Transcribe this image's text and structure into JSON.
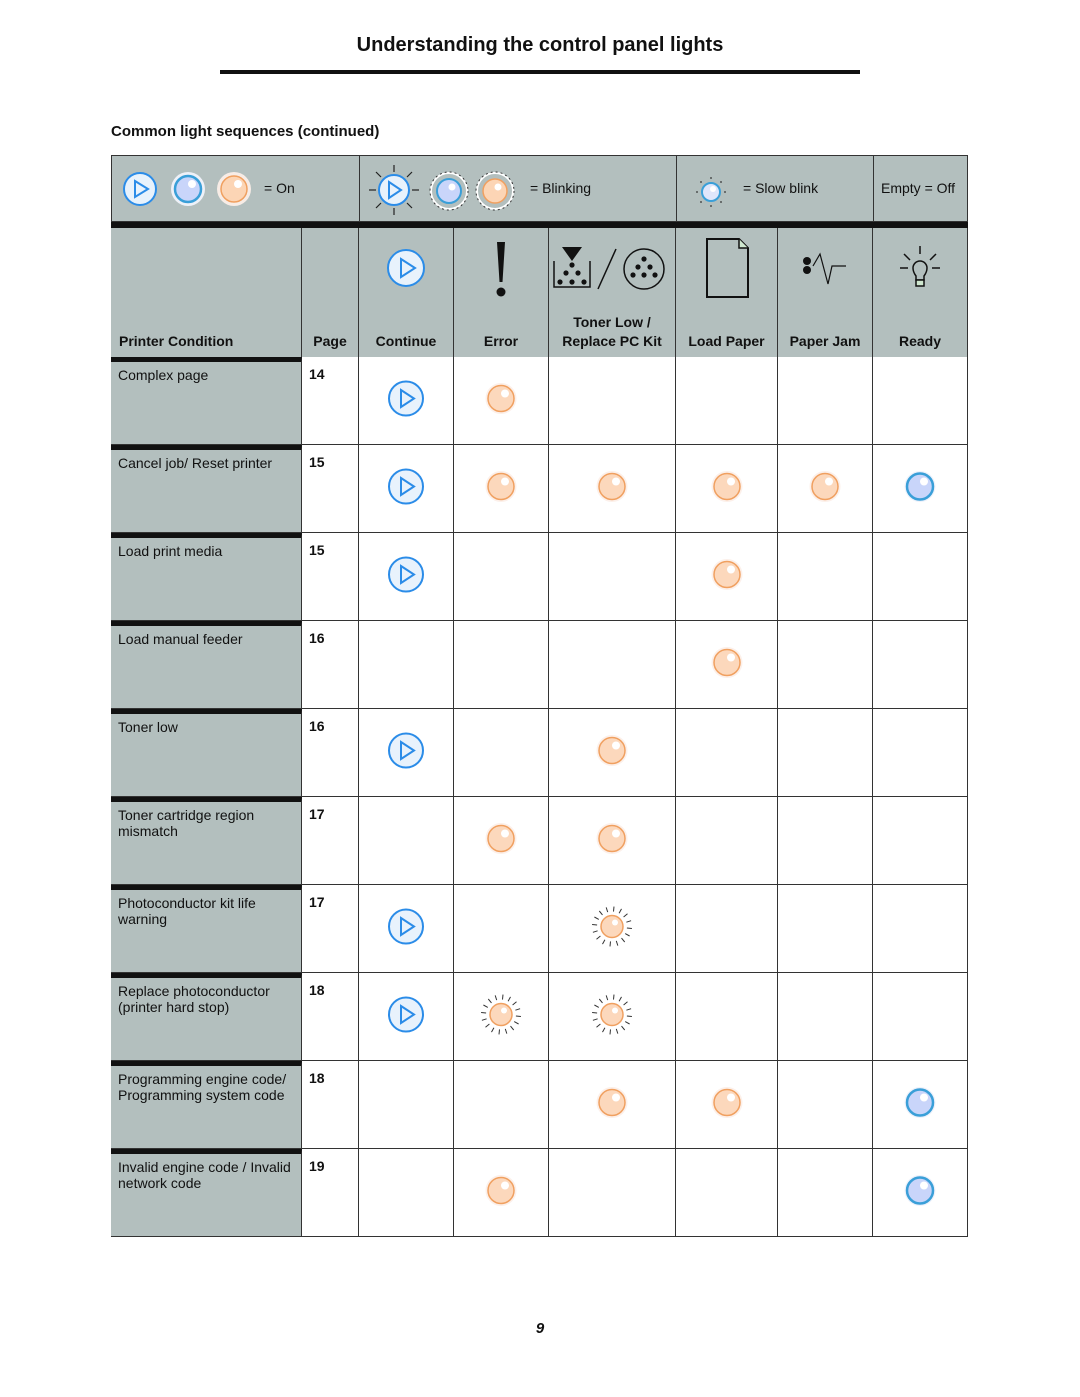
{
  "header": {
    "title": "Understanding the control panel lights",
    "section_title": "Common light sequences (continued)"
  },
  "legend": {
    "on_label": "= On",
    "blinking_label": "= Blinking",
    "slow_blink_label": "= Slow blink",
    "off_label": "Empty = Off"
  },
  "columns": [
    {
      "key": "condition",
      "label": "Printer Condition",
      "icon": ""
    },
    {
      "key": "page",
      "label": "Page",
      "icon": ""
    },
    {
      "key": "continue",
      "label": "Continue",
      "icon": "continue-button-icon"
    },
    {
      "key": "error",
      "label": "Error",
      "icon": "exclamation-icon"
    },
    {
      "key": "toner",
      "label": "Toner Low / Replace PC Kit",
      "label_line1": "Toner Low /",
      "label_line2": "Replace PC Kit",
      "icon": "toner-pc-kit-icon"
    },
    {
      "key": "load_paper",
      "label": "Load Paper",
      "icon": "paper-sheet-icon"
    },
    {
      "key": "paper_jam",
      "label": "Paper Jam",
      "icon": "paper-jam-icon"
    },
    {
      "key": "ready",
      "label": "Ready",
      "icon": "lightbulb-icon"
    }
  ],
  "light_states": {
    "on": "On",
    "blinking": "Blinking",
    "slow_blink": "Slow blink",
    "off": "Off"
  },
  "colors": {
    "header_bg": "#b3bfbe",
    "blue_light": "#3a9fd8",
    "orange_light": "#f0a060",
    "continue_blue": "#2b8ce8"
  },
  "rows": [
    {
      "condition": "Complex page",
      "page": "14",
      "continue": "on",
      "error": "on",
      "toner": "",
      "load_paper": "",
      "paper_jam": "",
      "ready": ""
    },
    {
      "condition": "Cancel job/ Reset printer",
      "page": "15",
      "continue": "on",
      "error": "on",
      "toner": "on",
      "load_paper": "on",
      "paper_jam": "on",
      "ready": "on"
    },
    {
      "condition": "Load print media",
      "page": "15",
      "continue": "on",
      "error": "",
      "toner": "",
      "load_paper": "on",
      "paper_jam": "",
      "ready": ""
    },
    {
      "condition": "Load manual feeder",
      "page": "16",
      "continue": "",
      "error": "",
      "toner": "",
      "load_paper": "on",
      "paper_jam": "",
      "ready": ""
    },
    {
      "condition": "Toner low",
      "page": "16",
      "continue": "on",
      "error": "",
      "toner": "on",
      "load_paper": "",
      "paper_jam": "",
      "ready": ""
    },
    {
      "condition": "Toner cartridge region mismatch",
      "page": "17",
      "continue": "",
      "error": "on",
      "toner": "on",
      "load_paper": "",
      "paper_jam": "",
      "ready": ""
    },
    {
      "condition": "Photoconductor kit life warning",
      "page": "17",
      "continue": "on",
      "error": "",
      "toner": "blinking",
      "load_paper": "",
      "paper_jam": "",
      "ready": ""
    },
    {
      "condition": "Replace photoconductor (printer hard stop)",
      "page": "18",
      "continue": "on",
      "error": "blinking",
      "toner": "blinking",
      "load_paper": "",
      "paper_jam": "",
      "ready": ""
    },
    {
      "condition": "Programming engine code/ Programming system code",
      "page": "18",
      "continue": "",
      "error": "",
      "toner": "on",
      "load_paper": "on",
      "paper_jam": "",
      "ready": "on"
    },
    {
      "condition": "Invalid engine code / Invalid network code",
      "page": "19",
      "continue": "",
      "error": "on",
      "toner": "",
      "load_paper": "",
      "paper_jam": "",
      "ready": "on"
    }
  ],
  "footer": {
    "page_number": "9"
  }
}
